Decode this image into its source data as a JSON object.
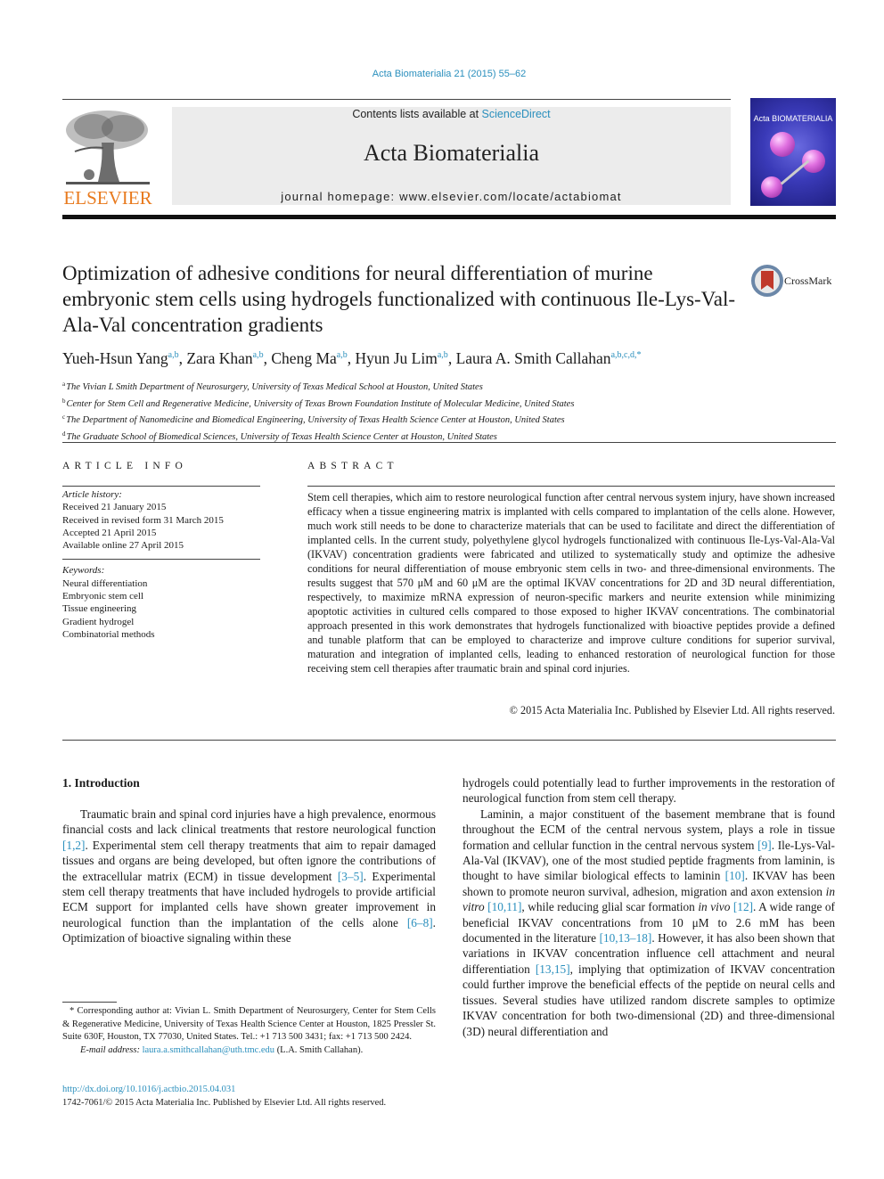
{
  "header": {
    "running_head": "Acta Biomaterialia 21 (2015) 55–62",
    "contents_prefix": "Contents lists available at ",
    "contents_link": "ScienceDirect",
    "journal_title": "Acta Biomaterialia",
    "homepage": "journal homepage: www.elsevier.com/locate/actabiomat",
    "publisher_logo": "ELSEVIER",
    "cover_title": "Acta BIOMATERIALIA",
    "crossmark_label": "CrossMark",
    "colors": {
      "link": "#2a8fbd",
      "elsevier_orange": "#e87a1e",
      "banner_bg": "#ececec"
    }
  },
  "article": {
    "title": "Optimization of adhesive conditions for neural differentiation of murine embryonic stem cells using hydrogels functionalized with continuous Ile-Lys-Val-Ala-Val concentration gradients",
    "authors": [
      {
        "name": "Yueh-Hsun Yang",
        "sup": "a,b"
      },
      {
        "name": "Zara Khan",
        "sup": "a,b"
      },
      {
        "name": "Cheng Ma",
        "sup": "a,b"
      },
      {
        "name": "Hyun Ju Lim",
        "sup": "a,b"
      },
      {
        "name": "Laura A. Smith Callahan",
        "sup": "a,b,c,d,*"
      }
    ],
    "affiliations": [
      {
        "key": "a",
        "text": "The Vivian L Smith Department of Neurosurgery, University of Texas Medical School at Houston, United States"
      },
      {
        "key": "b",
        "text": "Center for Stem Cell and Regenerative Medicine, University of Texas Brown Foundation Institute of Molecular Medicine, United States"
      },
      {
        "key": "c",
        "text": "The Department of Nanomedicine and Biomedical Engineering, University of Texas Health Science Center at Houston, United States"
      },
      {
        "key": "d",
        "text": "The Graduate School of Biomedical Sciences, University of Texas Health Science Center at Houston, United States"
      }
    ]
  },
  "article_info": {
    "heading": "ARTICLE INFO",
    "history_label": "Article history:",
    "history": [
      "Received 21 January 2015",
      "Received in revised form 31 March 2015",
      "Accepted 21 April 2015",
      "Available online 27 April 2015"
    ],
    "keywords_label": "Keywords:",
    "keywords": [
      "Neural differentiation",
      "Embryonic stem cell",
      "Tissue engineering",
      "Gradient hydrogel",
      "Combinatorial methods"
    ]
  },
  "abstract": {
    "heading": "ABSTRACT",
    "text": "Stem cell therapies, which aim to restore neurological function after central nervous system injury, have shown increased efficacy when a tissue engineering matrix is implanted with cells compared to implantation of the cells alone. However, much work still needs to be done to characterize materials that can be used to facilitate and direct the differentiation of implanted cells. In the current study, polyethylene glycol hydrogels functionalized with continuous Ile-Lys-Val-Ala-Val (IKVAV) concentration gradients were fabricated and utilized to systematically study and optimize the adhesive conditions for neural differentiation of mouse embryonic stem cells in two- and three-dimensional environments. The results suggest that 570 μM and 60 μM are the optimal IKVAV concentrations for 2D and 3D neural differentiation, respectively, to maximize mRNA expression of neuron-specific markers and neurite extension while minimizing apoptotic activities in cultured cells compared to those exposed to higher IKVAV concentrations. The combinatorial approach presented in this work demonstrates that hydrogels functionalized with bioactive peptides provide a defined and tunable platform that can be employed to characterize and improve culture conditions for superior survival, maturation and integration of implanted cells, leading to enhanced restoration of neurological function for those receiving stem cell therapies after traumatic brain and spinal cord injuries.",
    "copyright": "© 2015 Acta Materialia Inc. Published by Elsevier Ltd. All rights reserved."
  },
  "body": {
    "section_heading": "1. Introduction",
    "left_para": [
      {
        "t": "Traumatic brain and spinal cord injuries have a high prevalence, enormous financial costs and lack clinical treatments that restore neurological function "
      },
      {
        "ref": "[1,2]"
      },
      {
        "t": ". Experimental stem cell therapy treatments that aim to repair damaged tissues and organs are being developed, but often ignore the contributions of the extracellular matrix (ECM) in tissue development "
      },
      {
        "ref": "[3–5]"
      },
      {
        "t": ". Experimental stem cell therapy treatments that have included hydrogels to provide artificial ECM support for implanted cells have shown greater improvement in neurological function than the implantation of the cells alone "
      },
      {
        "ref": "[6–8]"
      },
      {
        "t": ". Optimization of bioactive signaling within these"
      }
    ],
    "right_para1": "hydrogels could potentially lead to further improvements in the restoration of neurological function from stem cell therapy.",
    "right_para2": [
      {
        "t": "Laminin, a major constituent of the basement membrane that is found throughout the ECM of the central nervous system, plays a role in tissue formation and cellular function in the central nervous system "
      },
      {
        "ref": "[9]"
      },
      {
        "t": ". Ile-Lys-Val-Ala-Val (IKVAV), one of the most studied peptide fragments from laminin, is thought to have similar biological effects to laminin "
      },
      {
        "ref": "[10]"
      },
      {
        "t": ". IKVAV has been shown to promote neuron survival, adhesion, migration and axon extension "
      },
      {
        "i": "in vitro"
      },
      {
        "t": " "
      },
      {
        "ref": "[10,11]"
      },
      {
        "t": ", while reducing glial scar formation "
      },
      {
        "i": "in vivo"
      },
      {
        "t": " "
      },
      {
        "ref": "[12]"
      },
      {
        "t": ". A wide range of beneficial IKVAV concentrations from 10 μM to 2.6 mM has been documented in the literature "
      },
      {
        "ref": "[10,13–18]"
      },
      {
        "t": ". However, it has also been shown that variations in IKVAV concentration influence cell attachment and neural differentiation "
      },
      {
        "ref": "[13,15]"
      },
      {
        "t": ", implying that optimization of IKVAV concentration could further improve the beneficial effects of the peptide on neural cells and tissues. Several studies have utilized random discrete samples to optimize IKVAV concentration for both two-dimensional (2D) and three-dimensional (3D) neural differentiation and"
      }
    ]
  },
  "footnote": {
    "corresponding": "* Corresponding author at: Vivian L. Smith Department of Neurosurgery, Center for Stem Cells & Regenerative Medicine, University of Texas Health Science Center at Houston, 1825 Pressler St. Suite 630F, Houston, TX 77030, United States. Tel.: +1 713 500 3431; fax: +1 713 500 2424.",
    "email_label": "E-mail address: ",
    "email": "laura.a.smithcallahan@uth.tmc.edu",
    "email_suffix": " (L.A. Smith Callahan).",
    "doi": "http://dx.doi.org/10.1016/j.actbio.2015.04.031",
    "issn_line": "1742-7061/© 2015 Acta Materialia Inc. Published by Elsevier Ltd. All rights reserved."
  }
}
